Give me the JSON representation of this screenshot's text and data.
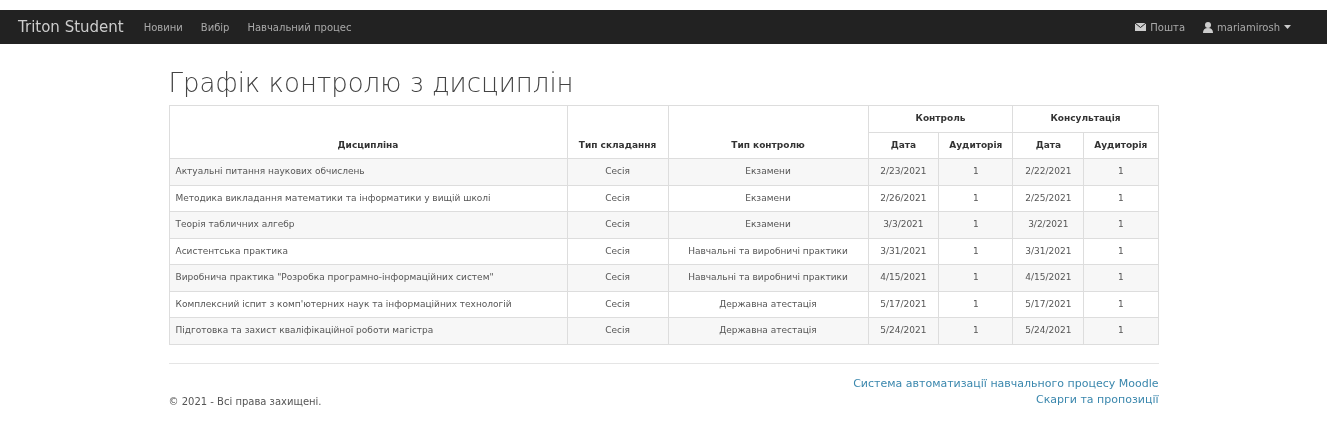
{
  "navbar": {
    "brand": "Triton Student",
    "links": [
      "Новини",
      "Вибір",
      "Навчальний процес"
    ],
    "mail": "Пошта",
    "user": "mariamirosh"
  },
  "title": "Графік контролю з дисциплін",
  "table": {
    "columns": [
      "Дисципліна",
      "Тип складання",
      "Тип контролю"
    ],
    "groups": [
      {
        "label": "Контроль",
        "columns": [
          "Дата",
          "Аудиторія"
        ]
      },
      {
        "label": "Консультація",
        "columns": [
          "Дата",
          "Аудиторія"
        ]
      }
    ],
    "rows": [
      [
        "Актуальні питання наукових обчислень",
        "Сесія",
        "Екзамени",
        "2/23/2021",
        "1",
        "2/22/2021",
        "1"
      ],
      [
        "Методика викладання математики та інформатики у вищій школі",
        "Сесія",
        "Екзамени",
        "2/26/2021",
        "1",
        "2/25/2021",
        "1"
      ],
      [
        "Теорія табличних алгебр",
        "Сесія",
        "Екзамени",
        "3/3/2021",
        "1",
        "3/2/2021",
        "1"
      ],
      [
        "Асистентська практика",
        "Сесія",
        "Навчальні та виробничі практики",
        "3/31/2021",
        "1",
        "3/31/2021",
        "1"
      ],
      [
        "Виробнича практика \"Розробка програмно-інформаційних систем\"",
        "Сесія",
        "Навчальні та виробничі практики",
        "4/15/2021",
        "1",
        "4/15/2021",
        "1"
      ],
      [
        "Комплексний іспит з комп'ютерних наук та інформаційних технологій",
        "Сесія",
        "Державна атестація",
        "5/17/2021",
        "1",
        "5/17/2021",
        "1"
      ],
      [
        "Підготовка та захист кваліфікаційної роботи магістра",
        "Сесія",
        "Державна атестація",
        "5/24/2021",
        "1",
        "5/24/2021",
        "1"
      ]
    ]
  },
  "footer": {
    "copyright": "© 2021 - Всі права захищені.",
    "links": [
      "Система автоматизації навчального процесу Moodle",
      "Скарги та пропозиції"
    ]
  }
}
